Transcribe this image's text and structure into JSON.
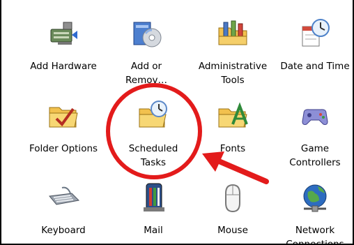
{
  "items": [
    {
      "label": "Add Hardware",
      "icon": "add-hardware-icon"
    },
    {
      "label": "Add or\nRemov…",
      "icon": "add-remove-programs-icon"
    },
    {
      "label": "Administrative\nTools",
      "icon": "administrative-tools-icon"
    },
    {
      "label": "Date and Time",
      "icon": "date-time-icon"
    },
    {
      "label": "Folder Options",
      "icon": "folder-options-icon"
    },
    {
      "label": "Scheduled\nTasks",
      "icon": "scheduled-tasks-icon"
    },
    {
      "label": "Fonts",
      "icon": "fonts-icon"
    },
    {
      "label": "Game\nControllers",
      "icon": "game-controllers-icon"
    },
    {
      "label": "Keyboard",
      "icon": "keyboard-icon"
    },
    {
      "label": "Mail",
      "icon": "mail-icon"
    },
    {
      "label": "Mouse",
      "icon": "mouse-icon"
    },
    {
      "label": "Network\nConnections",
      "icon": "network-connections-icon"
    }
  ],
  "annotation": {
    "color": "#e31b1b",
    "highlight": "circle",
    "pointer": "arrow"
  }
}
